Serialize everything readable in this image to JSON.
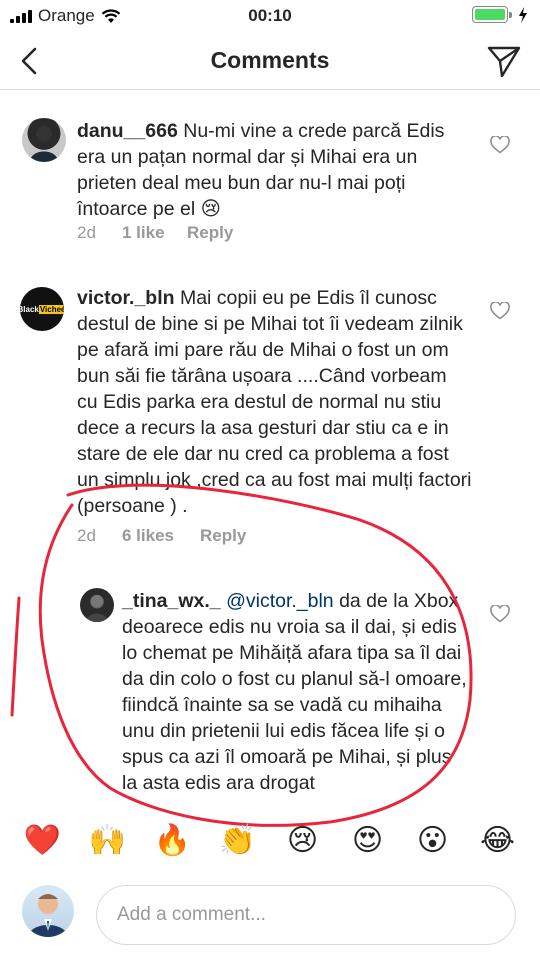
{
  "status": {
    "carrier": "Orange",
    "time": "00:10"
  },
  "nav": {
    "title": "Comments"
  },
  "comments": [
    {
      "username": "danu__666",
      "text": " Nu-mi vine a crede parcă Edis era un pațan normal dar și Mihai era un prieten deal meu bun dar nu-l mai poți întoarce pe el 😢",
      "time": "2d",
      "likes": "1 like",
      "reply": "Reply"
    },
    {
      "username": "victor._bln",
      "avatar_text": "Black Vicheé",
      "text": " Mai copii eu pe Edis îl cunosc destul de bine si pe Mihai tot îi vedeam zilnik pe afară imi pare rău de Mihai o fost un om bun săi fie tărâna ușoara ....Când vorbeam cu Edis parka era destul de normal nu stiu dece a recurs la asa gesturi dar stiu ca e in stare de ele dar nu cred ca problema a fost un simplu jok ,cred ca au fost mai mulți factori (persoane ) .",
      "time": "2d",
      "likes": "6 likes",
      "reply": "Reply"
    },
    {
      "username": "_tina_wx._",
      "mention": "@victor._bln",
      "text": " da de la Xbox deoarece edis nu vroia sa il dai, și edis lo chemat pe Mihăiță afara tipa sa îl dai da din colo o fost cu planul să-l omoare, fiindcă înainte sa se vadă cu mihaiha unu din prietenii lui edis făcea life și o spus ca azi îl omoară pe Mihai, și plus la asta edis ara drogat"
    }
  ],
  "emojis": [
    "❤️",
    "🙌",
    "🔥",
    "👏",
    "😢",
    "😍",
    "😮",
    "😂"
  ],
  "compose": {
    "placeholder": "Add a comment..."
  },
  "colors": {
    "annotation": "#e8253a",
    "accent_green": "#4cd964"
  }
}
